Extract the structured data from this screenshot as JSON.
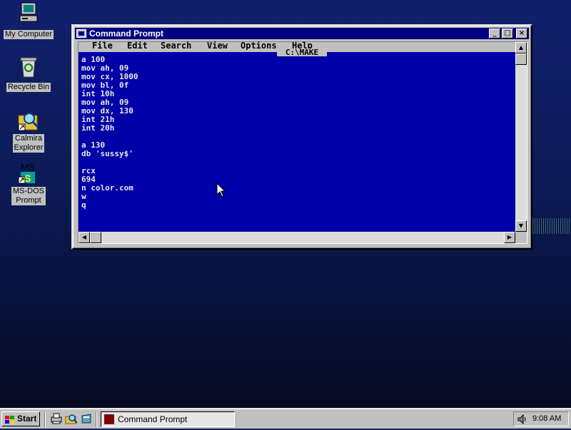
{
  "desktop": {
    "icons": [
      {
        "label": "My Computer"
      },
      {
        "label": "Recycle Bin"
      },
      {
        "label": "Calmira\nExplorer"
      },
      {
        "label": "MS-DOS\nPrompt"
      }
    ]
  },
  "window": {
    "title": "Command Prompt",
    "buttons": {
      "minimize": "_",
      "maximize": "□",
      "close": "×"
    },
    "menu": [
      "File",
      "Edit",
      "Search",
      "View",
      "Options",
      "Help"
    ],
    "dos_title": "C:\\MAKE",
    "lines": [
      "a 100",
      "mov ah, 09",
      "mov cx, 1000",
      "mov bl, 0f",
      "int 10h",
      "mov ah, 09",
      "mov dx, 130",
      "int 21h",
      "int 20h",
      "",
      "a 130",
      "db 'sussy$'",
      "",
      "rcx",
      "694",
      "n color.com",
      "w",
      "q"
    ]
  },
  "taskbar": {
    "start_label": "Start",
    "task_label": "Command Prompt",
    "clock": "9:08 AM"
  },
  "colors": {
    "titlebar": "#000080",
    "dos_bg": "#0000a8",
    "chrome": "#c0c0c0"
  }
}
